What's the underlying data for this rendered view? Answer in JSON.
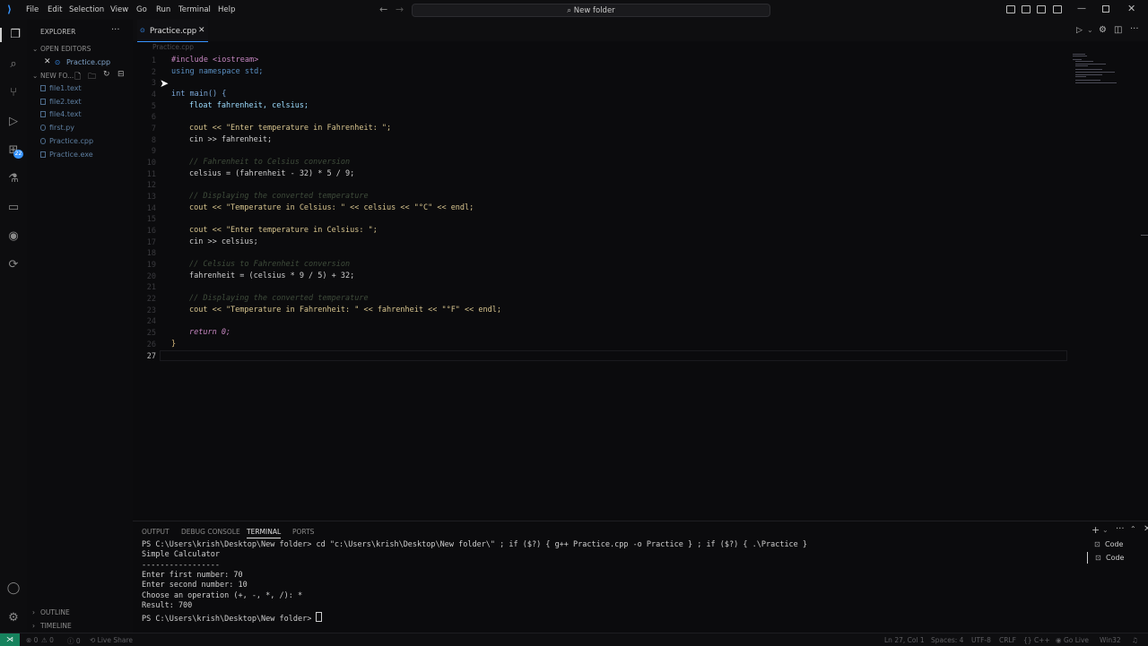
{
  "menu": [
    "File",
    "Edit",
    "Selection",
    "View",
    "Go",
    "Run",
    "Terminal",
    "Help"
  ],
  "search": {
    "text": "New folder"
  },
  "explorer": {
    "title": "EXPLORER",
    "open_editors": "OPEN EDITORS",
    "open_file": "Practice.cpp",
    "folder": "NEW FO...",
    "files": [
      "file1.text",
      "file2.text",
      "file4.text",
      "first.py",
      "Practice.cpp",
      "Practice.exe"
    ],
    "outline": "OUTLINE",
    "timeline": "TIMELINE"
  },
  "activity": {
    "badge": "22"
  },
  "tabs": {
    "active": "Practice.cpp",
    "breadcrumb": "Practice.cpp"
  },
  "code": {
    "l1": "#include <iostream>",
    "l2": "using namespace std;",
    "l4": "int main() {",
    "l5": "float fahrenheit, celsius;",
    "l7": "cout << \"Enter temperature in Fahrenheit: \";",
    "l8": "cin >> fahrenheit;",
    "l10": "// Fahrenheit to Celsius conversion",
    "l11": "celsius = (fahrenheit - 32) * 5 / 9;",
    "l13": "// Displaying the converted temperature",
    "l14": "cout << \"Temperature in Celsius: \" << celsius << \"°C\" << endl;",
    "l16": "cout << \"Enter temperature in Celsius: \";",
    "l17": "cin >> celsius;",
    "l19": "// Celsius to Fahrenheit conversion",
    "l20": "fahrenheit = (celsius * 9 / 5) + 32;",
    "l22": "// Displaying the converted temperature",
    "l23": "cout << \"Temperature in Fahrenheit: \" << fahrenheit << \"°F\" << endl;",
    "l25": "return 0;",
    "l26": "}",
    "last_line_no": "27"
  },
  "panel": {
    "tabs": [
      "OUTPUT",
      "DEBUG CONSOLE",
      "TERMINAL",
      "PORTS"
    ],
    "terminals": [
      "Code",
      "Code"
    ],
    "lines": [
      "PS C:\\Users\\krish\\Desktop\\New folder> cd \"c:\\Users\\krish\\Desktop\\New folder\\\" ; if ($?) { g++ Practice.cpp -o Practice } ; if ($?) { .\\Practice }",
      "Simple Calculator",
      "-----------------",
      "Enter first number: 70",
      "Enter second number: 10",
      "Choose an operation (+, -, *, /): *",
      "Result: 700",
      "PS C:\\Users\\krish\\Desktop\\New folder> "
    ]
  },
  "status": {
    "errors": "0",
    "warnings": "0",
    "info": "0",
    "live_share": "Live Share",
    "position": "Ln 27, Col 1",
    "spaces": "Spaces: 4",
    "encoding": "UTF-8",
    "eol": "CRLF",
    "language": "C++",
    "go_live": "Go Live",
    "platform": "Win32"
  }
}
